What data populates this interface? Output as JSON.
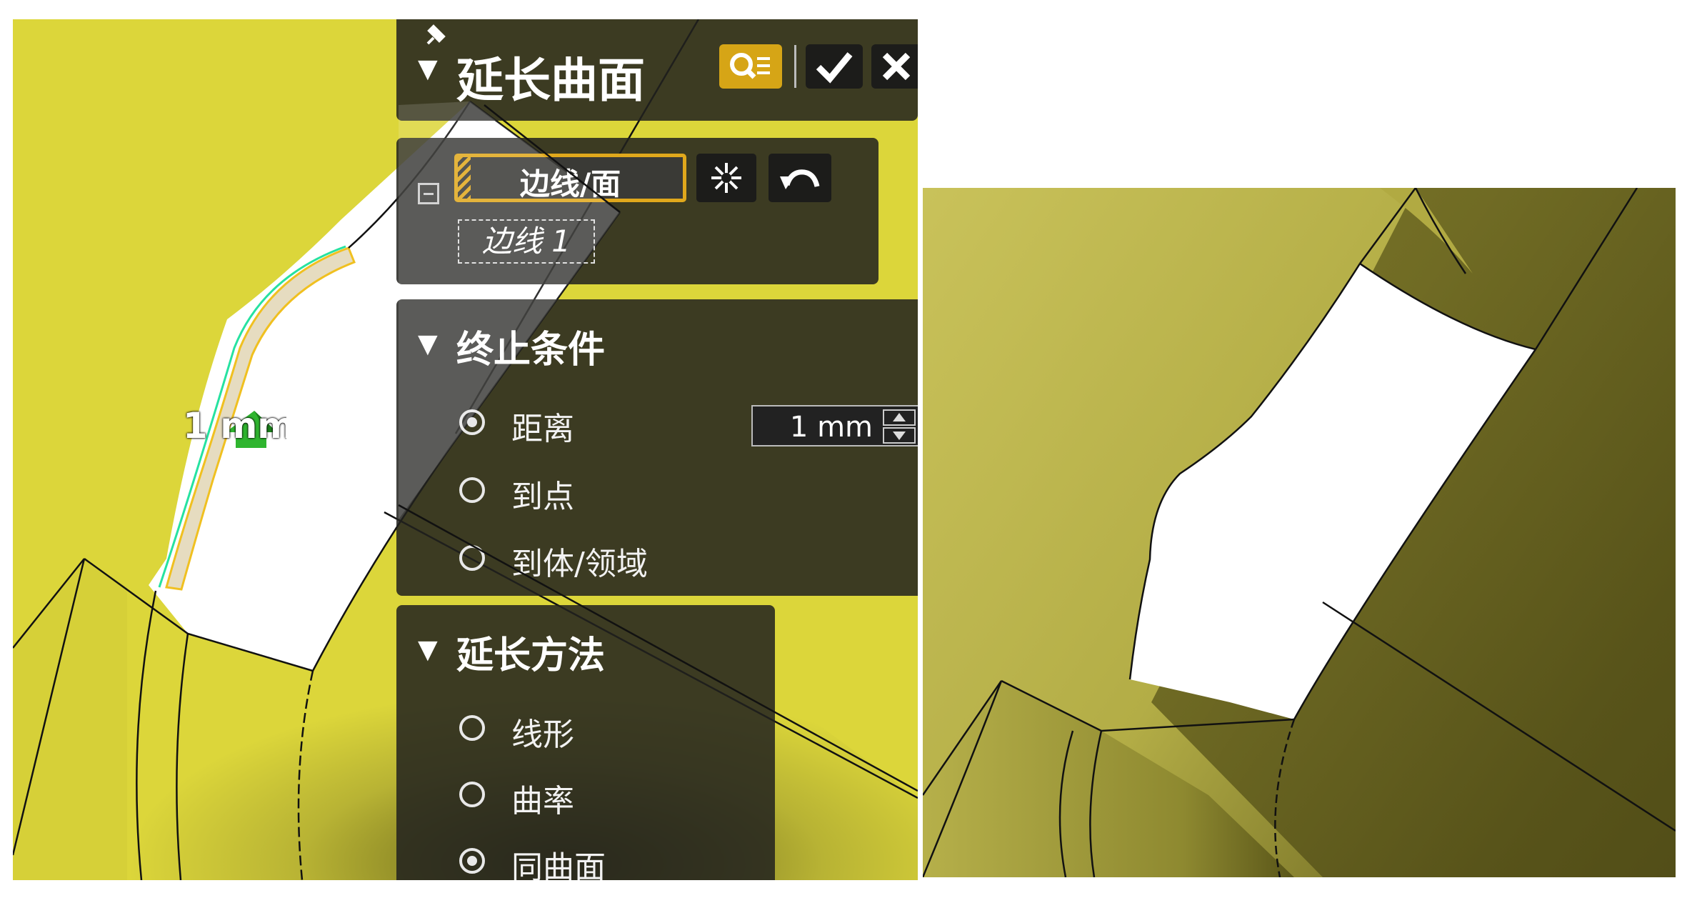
{
  "panel": {
    "title": "延长曲面",
    "pin_icon": "pin-icon",
    "preview_icon": "preview-eye-icon",
    "confirm_icon": "checkmark-icon",
    "cancel_icon": "close-icon",
    "selection": {
      "field_label": "边线/面",
      "selected_item": "边线 1",
      "collapse_icon": "collapse-minus-icon",
      "tangent_icon": "tangent-propagate-icon",
      "undo_icon": "undo-arrow-icon"
    },
    "end_condition": {
      "title": "终止条件",
      "options": [
        "距离",
        "到点",
        "到体/领域"
      ],
      "selected": "距离",
      "distance_value": "1 mm"
    },
    "extension_method": {
      "title": "延长方法",
      "options": [
        "线形",
        "曲率",
        "同曲面"
      ],
      "selected": "同曲面"
    }
  },
  "viewport": {
    "drag_label": "1 mm",
    "surface_color": "#dcd63a",
    "accent_color": "#d6a516"
  }
}
